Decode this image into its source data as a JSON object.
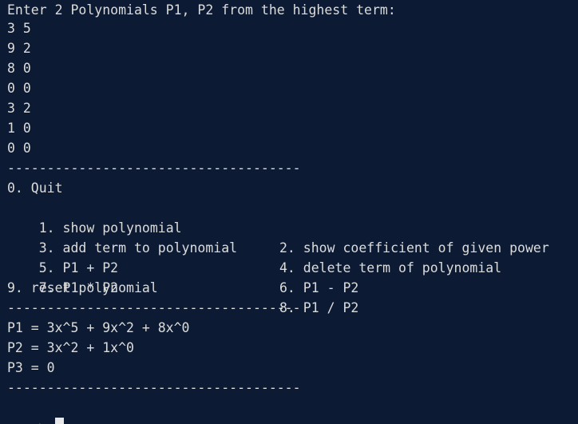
{
  "prompt_header": "Enter 2 Polynomials P1, P2 from the highest term:",
  "inputs": [
    "3 5",
    "9 2",
    "8 0",
    "0 0",
    "3 2",
    "1 0",
    "0 0"
  ],
  "separator": "-------------------------------------",
  "menu": {
    "quit": "0. Quit",
    "show_polynomial": "1. show polynomial",
    "show_coefficient": "2. show coefficient of given power",
    "add_term": "3. add term to polynomial",
    "delete_term": "4. delete term of polynomial",
    "add": "5. P1 + P2",
    "subtract": "6. P1 - P2",
    "multiply": "7. P1 * P2",
    "divide": "8. P1 / P2",
    "reset": "9. reset polynomial"
  },
  "results": {
    "p1": "P1 = 3x^5 + 9x^2 + 8x^0",
    "p2": "P2 = 3x^2 + 1x^0",
    "p3": "P3 = 0"
  },
  "command_prompt": ">"
}
